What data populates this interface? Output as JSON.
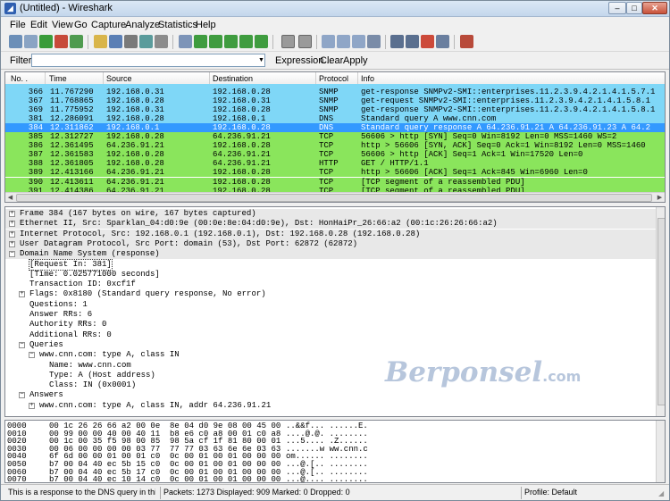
{
  "window": {
    "title": "(Untitled) - Wireshark"
  },
  "menu": [
    "File",
    "Edit",
    "View",
    "Go",
    "Capture",
    "Analyze",
    "Statistics",
    "Help"
  ],
  "filter": {
    "label": "Filter:",
    "value": "",
    "expression": "Expression...",
    "clear": "Clear",
    "apply": "Apply"
  },
  "packet_list": {
    "columns": [
      "No. .",
      "Time",
      "Source",
      "Destination",
      "Protocol",
      "Info"
    ],
    "rows": [
      {
        "no": "366",
        "time": "11.767290",
        "src": "192.168.0.31",
        "dst": "192.168.0.28",
        "proto": "SNMP",
        "info": "get-response SNMPv2-SMI::enterprises.11.2.3.9.4.2.1.4.1.5.7.1",
        "bg": "#7fd7f7",
        "fg": "#000000"
      },
      {
        "no": "367",
        "time": "11.768865",
        "src": "192.168.0.28",
        "dst": "192.168.0.31",
        "proto": "SNMP",
        "info": "get-request SNMPv2-SMI::enterprises.11.2.3.9.4.2.1.4.1.5.8.1",
        "bg": "#7fd7f7",
        "fg": "#000000"
      },
      {
        "no": "369",
        "time": "11.775952",
        "src": "192.168.0.31",
        "dst": "192.168.0.28",
        "proto": "SNMP",
        "info": "get-response SNMPv2-SMI::enterprises.11.2.3.9.4.2.1.4.1.5.8.1",
        "bg": "#7fd7f7",
        "fg": "#000000"
      },
      {
        "no": "381",
        "time": "12.286091",
        "src": "192.168.0.28",
        "dst": "192.168.0.1",
        "proto": "DNS",
        "info": "Standard query A www.cnn.com",
        "bg": "#7fd7f7",
        "fg": "#000000"
      },
      {
        "no": "384",
        "time": "12.311862",
        "src": "192.168.0.1",
        "dst": "192.168.0.28",
        "proto": "DNS",
        "info": "Standard query response A 64.236.91.21 A 64.236.91.23 A 64.2",
        "bg": "#3399ff",
        "fg": "#ffffff"
      },
      {
        "no": "385",
        "time": "12.312727",
        "src": "192.168.0.28",
        "dst": "64.236.91.21",
        "proto": "TCP",
        "info": "56606 > http [SYN] Seq=0 Win=8192 Len=0 MSS=1460 WS=2",
        "bg": "#8ae55c",
        "fg": "#000000"
      },
      {
        "no": "386",
        "time": "12.361495",
        "src": "64.236.91.21",
        "dst": "192.168.0.28",
        "proto": "TCP",
        "info": "http > 56606 [SYN, ACK] Seq=0 Ack=1 Win=8192 Len=0 MSS=1460",
        "bg": "#8ae55c",
        "fg": "#000000"
      },
      {
        "no": "387",
        "time": "12.361583",
        "src": "192.168.0.28",
        "dst": "64.236.91.21",
        "proto": "TCP",
        "info": "56606 > http [ACK] Seq=1 Ack=1 Win=17520 Len=0",
        "bg": "#8ae55c",
        "fg": "#000000"
      },
      {
        "no": "388",
        "time": "12.361805",
        "src": "192.168.0.28",
        "dst": "64.236.91.21",
        "proto": "HTTP",
        "info": "GET / HTTP/1.1",
        "bg": "#8ae55c",
        "fg": "#000000"
      },
      {
        "no": "389",
        "time": "12.413166",
        "src": "64.236.91.21",
        "dst": "192.168.0.28",
        "proto": "TCP",
        "info": "http > 56606 [ACK] Seq=1 Ack=845 Win=6960 Len=0",
        "bg": "#8ae55c",
        "fg": "#000000"
      },
      {
        "no": "390",
        "time": "12.413611",
        "src": "64.236.91.21",
        "dst": "192.168.0.28",
        "proto": "TCP",
        "info": "[TCP segment of a reassembled PDU]",
        "bg": "#8ae55c",
        "fg": "#000000"
      },
      {
        "no": "391",
        "time": "12.414386",
        "src": "64.236.91.21",
        "dst": "192.168.0.28",
        "proto": "TCP",
        "info": "[TCP segment of a reassembled PDU]",
        "bg": "#8ae55c",
        "fg": "#000000"
      }
    ]
  },
  "details": [
    {
      "indent": 0,
      "toggle": "+",
      "text": "Frame 384 (167 bytes on wire, 167 bytes captured)",
      "header": true
    },
    {
      "indent": 0,
      "toggle": "+",
      "text": "Ethernet II, Src: Sparklan_04:d0:9e (00:0e:8e:04:d0:9e), Dst: HonHaiPr_26:66:a2 (00:1c:26:26:66:a2)",
      "header": true
    },
    {
      "indent": 0,
      "toggle": "+",
      "text": "Internet Protocol, Src: 192.168.0.1 (192.168.0.1), Dst: 192.168.0.28 (192.168.0.28)",
      "header": true
    },
    {
      "indent": 0,
      "toggle": "+",
      "text": "User Datagram Protocol, Src Port: domain (53), Dst Port: 62872 (62872)",
      "header": true
    },
    {
      "indent": 0,
      "toggle": "-",
      "text": "Domain Name System (response)",
      "header": true
    },
    {
      "indent": 1,
      "toggle": "",
      "text": "[Request In: 381]",
      "boxed": true
    },
    {
      "indent": 1,
      "toggle": "",
      "text": "[Time: 0.025771000 seconds]"
    },
    {
      "indent": 1,
      "toggle": "",
      "text": "Transaction ID: 0xcf1f"
    },
    {
      "indent": 1,
      "toggle": "+",
      "text": "Flags: 0x8180 (Standard query response, No error)"
    },
    {
      "indent": 1,
      "toggle": "",
      "text": "Questions: 1"
    },
    {
      "indent": 1,
      "toggle": "",
      "text": "Answer RRs: 6"
    },
    {
      "indent": 1,
      "toggle": "",
      "text": "Authority RRs: 0"
    },
    {
      "indent": 1,
      "toggle": "",
      "text": "Additional RRs: 0"
    },
    {
      "indent": 1,
      "toggle": "-",
      "text": "Queries"
    },
    {
      "indent": 2,
      "toggle": "-",
      "text": "www.cnn.com: type A, class IN"
    },
    {
      "indent": 3,
      "toggle": "",
      "text": "Name: www.cnn.com"
    },
    {
      "indent": 3,
      "toggle": "",
      "text": "Type: A (Host address)"
    },
    {
      "indent": 3,
      "toggle": "",
      "text": "Class: IN (0x0001)"
    },
    {
      "indent": 1,
      "toggle": "-",
      "text": "Answers"
    },
    {
      "indent": 2,
      "toggle": "+",
      "text": "www.cnn.com: type A, class IN, addr 64.236.91.21"
    }
  ],
  "watermark": {
    "brand": "Berponsel",
    "suffix": ".com"
  },
  "bytes": [
    {
      "offset": "0000",
      "hex": "00 1c 26 26 66 a2 00 0e  8e 04 d0 9e 08 00 45 00",
      "ascii": "..&&f... ......E."
    },
    {
      "offset": "0010",
      "hex": "00 99 00 00 40 00 40 11  b8 e6 c0 a8 00 01 c0 a8",
      "ascii": "....@.@. ........"
    },
    {
      "offset": "0020",
      "hex": "00 1c 00 35 f5 98 00 85  98 5a cf 1f 81 80 00 01",
      "ascii": "...5.... .Z......"
    },
    {
      "offset": "0030",
      "hex": "00 06 00 00 00 00 03 77  77 77 03 63 6e 6e 03 63",
      "ascii": ".......w ww.cnn.c"
    },
    {
      "offset": "0040",
      "hex": "6f 6d 00 00 01 00 01 c0  0c 00 01 00 01 00 00 00",
      "ascii": "om...... ........"
    },
    {
      "offset": "0050",
      "hex": "b7 00 04 40 ec 5b 15 c0  0c 00 01 00 01 00 00 00",
      "ascii": "...@.[.. ........"
    },
    {
      "offset": "0060",
      "hex": "b7 00 04 40 ec 5b 17 c0  0c 00 01 00 01 00 00 00",
      "ascii": "...@.[.. ........"
    },
    {
      "offset": "0070",
      "hex": "b7 00 04 40 ec 10 14 c0  0c 00 01 00 01 00 00 00",
      "ascii": "...@.... ........"
    }
  ],
  "status": {
    "hint": "This is a response to the DNS query in this fr...",
    "counts": "Packets: 1273 Displayed: 909 Marked: 0 Dropped: 0",
    "profile": "Profile: Default"
  }
}
